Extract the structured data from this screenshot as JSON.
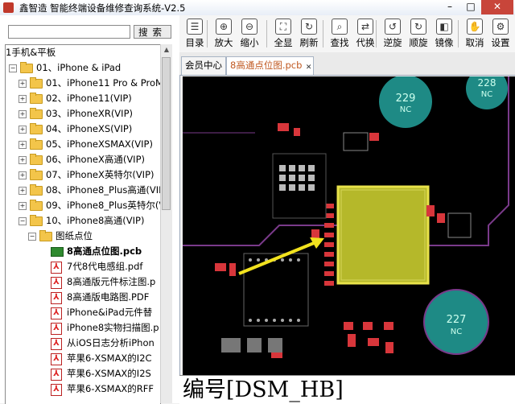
{
  "window": {
    "title": "鑫智造 智能终端设备维修查询系统-V2.5",
    "minimize": "–",
    "maximize": "□",
    "close": "✕"
  },
  "search": {
    "placeholder": "",
    "value": "",
    "button": "搜索"
  },
  "toolbar": [
    {
      "icon": "book-icon",
      "glyph": "☰",
      "label": "目录"
    },
    {
      "icon": "zoom-in-icon",
      "glyph": "⊕",
      "label": "放大"
    },
    {
      "icon": "zoom-out-icon",
      "glyph": "⊖",
      "label": "缩小"
    },
    {
      "icon": "fit-screen-icon",
      "glyph": "⛶",
      "label": "全显"
    },
    {
      "icon": "refresh-icon",
      "glyph": "↻",
      "label": "刷新"
    },
    {
      "icon": "search-icon",
      "glyph": "⌕",
      "label": "查找"
    },
    {
      "icon": "replace-icon",
      "glyph": "⇄",
      "label": "代换"
    },
    {
      "icon": "rotate-ccw-icon",
      "glyph": "↺",
      "label": "逆旋"
    },
    {
      "icon": "rotate-cw-icon",
      "glyph": "↻",
      "label": "顺旋"
    },
    {
      "icon": "mirror-icon",
      "glyph": "◧",
      "label": "镜像"
    },
    {
      "icon": "cancel-icon",
      "glyph": "✋",
      "label": "取消"
    },
    {
      "icon": "settings-icon",
      "glyph": "⚙",
      "label": "设置"
    }
  ],
  "tabs": [
    {
      "label": "会员中心",
      "active": false
    },
    {
      "label": "8高通点位图.pcb",
      "active": true,
      "close": "✕"
    }
  ],
  "tree": [
    {
      "text": "1手机&平板",
      "type": "root"
    },
    {
      "text": "01、iPhone & iPad",
      "type": "folder",
      "expander": "−"
    },
    {
      "text": "01、iPhone11 Pro & ProM",
      "type": "folder",
      "expander": "+"
    },
    {
      "text": "02、iPhone11(VIP)",
      "type": "folder",
      "expander": "+"
    },
    {
      "text": "03、iPhoneXR(VIP)",
      "type": "folder",
      "expander": "+"
    },
    {
      "text": "04、iPhoneXS(VIP)",
      "type": "folder",
      "expander": "+"
    },
    {
      "text": "05、iPhoneXSMAX(VIP)",
      "type": "folder",
      "expander": "+"
    },
    {
      "text": "06、iPhoneX高通(VIP)",
      "type": "folder",
      "expander": "+"
    },
    {
      "text": "07、iPhoneX英特尔(VIP)",
      "type": "folder",
      "expander": "+"
    },
    {
      "text": "08、iPhone8_Plus高通(VIP)",
      "type": "folder",
      "expander": "+"
    },
    {
      "text": "09、iPhone8_Plus英特尔(VI",
      "type": "folder",
      "expander": "+"
    },
    {
      "text": "10、iPhone8高通(VIP)",
      "type": "folder",
      "expander": "−"
    },
    {
      "text": "图纸点位",
      "type": "folder",
      "expander": "−"
    },
    {
      "text": "8高通点位图.pcb",
      "type": "pcb"
    },
    {
      "text": "7代8代电感组.pdf",
      "type": "pdf"
    },
    {
      "text": "8高通版元件标注图.p",
      "type": "pdf"
    },
    {
      "text": "8高通版电路图.PDF",
      "type": "pdf"
    },
    {
      "text": "iPhone&iPad元件替",
      "type": "pdf"
    },
    {
      "text": "iPhone8实物扫描图.p",
      "type": "pdf"
    },
    {
      "text": "从iOS日志分析iPhon",
      "type": "pdf"
    },
    {
      "text": "苹果6-XSMAX的I2C",
      "type": "pdf"
    },
    {
      "text": "苹果6-XSMAX的I2S",
      "type": "pdf"
    },
    {
      "text": "苹果6-XSMAX的RFF",
      "type": "pdf"
    }
  ],
  "pcb": {
    "pad_labels": [
      {
        "num": "229",
        "nc": "NC"
      },
      {
        "num": "228",
        "nc": "NC"
      },
      {
        "num": "227",
        "nc": "NC"
      }
    ]
  },
  "bottom_label": "编号[DSM_HB]",
  "colors": {
    "accent_tab": "#c05820",
    "pcb_bg": "#000000",
    "chip": "#b5b82a",
    "pad_red": "#d8363b",
    "arrow": "#f2e21e",
    "teal_pad": "#1e8a85"
  }
}
